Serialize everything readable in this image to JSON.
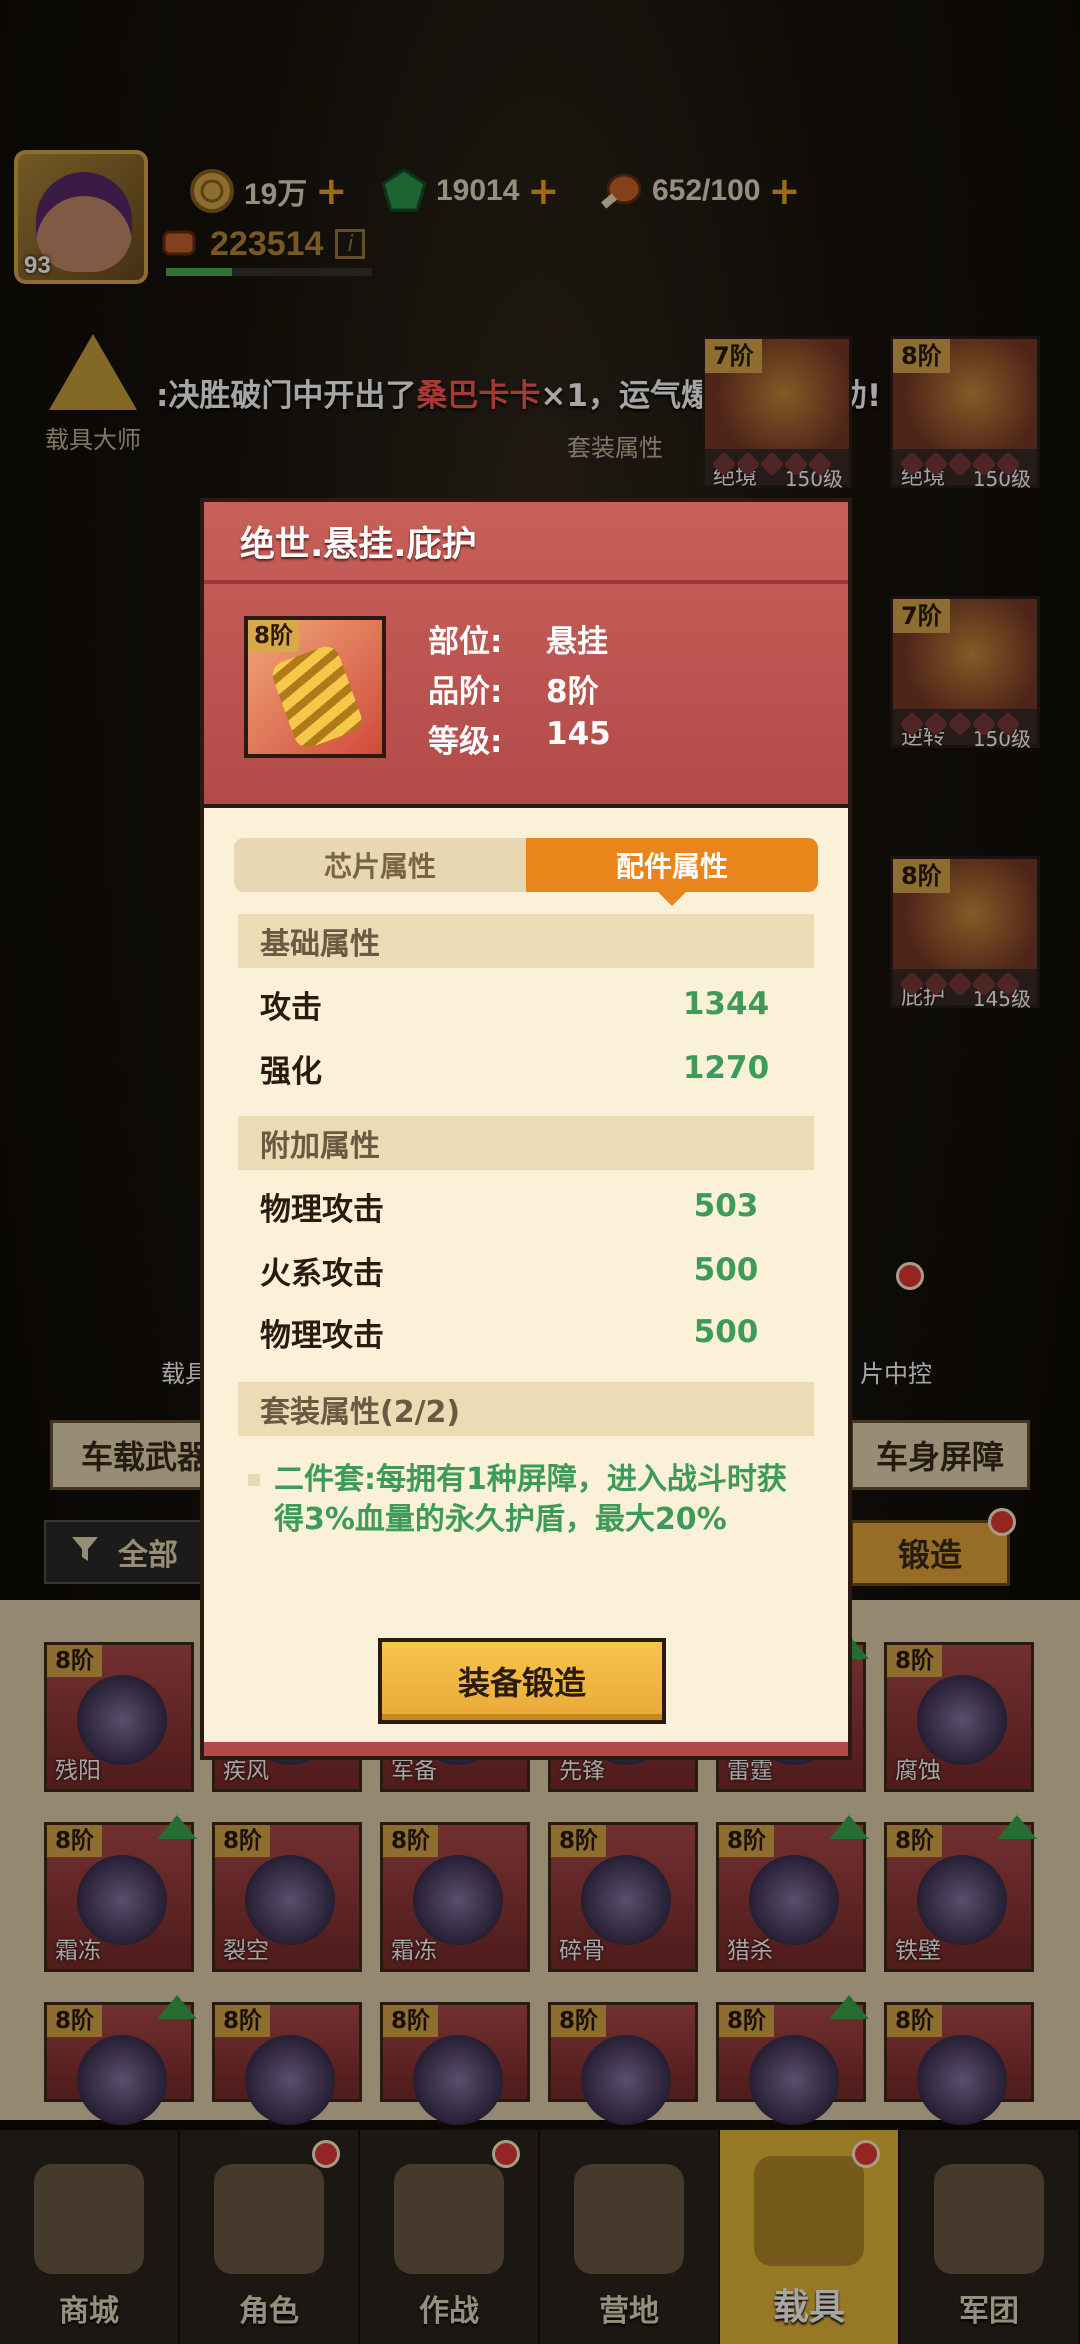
{
  "hud": {
    "player_level": "93",
    "gold": "19万",
    "gems": "19014",
    "stamina": "652/100",
    "power": "223514",
    "power_info": "i",
    "exp_progress": 0.32
  },
  "broadcast": {
    "prefix": ":决胜破门中开出了",
    "highlight": "桑巴卡卡",
    "suffix": "×1，运气爆表有如天助!"
  },
  "side_buttons": {
    "vehicle_master": "载具大师",
    "set_attributes": "套装属性",
    "vehicle_left": "载具",
    "chip_control": "片中控"
  },
  "right_gear": [
    {
      "tier": "7阶",
      "name": "绝境",
      "level": "150级"
    },
    {
      "tier": "8阶",
      "name": "绝境",
      "level": "150级"
    },
    {
      "tier": "7阶",
      "name": "逆转",
      "level": "150级"
    },
    {
      "tier": "8阶",
      "name": "庇护",
      "level": "145级"
    }
  ],
  "bg_tabs": {
    "left": "车载武器",
    "right": "车身屏障",
    "filter": "全部",
    "forge": "锻造"
  },
  "inventory": [
    {
      "tier": "8阶",
      "name": "残阳"
    },
    {
      "tier": "",
      "name": "疾风"
    },
    {
      "tier": "",
      "name": "军备"
    },
    {
      "tier": "",
      "name": "先锋"
    },
    {
      "tier": "",
      "name": "雷霆"
    },
    {
      "tier": "8阶",
      "name": "腐蚀"
    },
    {
      "tier": "8阶",
      "name": "霜冻"
    },
    {
      "tier": "8阶",
      "name": "裂空"
    },
    {
      "tier": "8阶",
      "name": "霜冻"
    },
    {
      "tier": "8阶",
      "name": "碎骨"
    },
    {
      "tier": "8阶",
      "name": "猎杀"
    },
    {
      "tier": "8阶",
      "name": "铁壁"
    },
    {
      "tier": "8阶",
      "name": ""
    },
    {
      "tier": "8阶",
      "name": ""
    },
    {
      "tier": "8阶",
      "name": ""
    },
    {
      "tier": "8阶",
      "name": ""
    },
    {
      "tier": "8阶",
      "name": ""
    },
    {
      "tier": "8阶",
      "name": ""
    }
  ],
  "nav": [
    {
      "label": "商城",
      "icon": "cart-icon"
    },
    {
      "label": "角色",
      "icon": "character-icon"
    },
    {
      "label": "作战",
      "icon": "battle-icon"
    },
    {
      "label": "营地",
      "icon": "camp-icon"
    },
    {
      "label": "载具",
      "icon": "vehicle-icon"
    },
    {
      "label": "军团",
      "icon": "legion-icon"
    }
  ],
  "modal": {
    "title": "绝世.悬挂.庇护",
    "item_tier": "8阶",
    "info": [
      {
        "key": "部位:",
        "value": "悬挂"
      },
      {
        "key": "品阶:",
        "value": "8阶"
      },
      {
        "key": "等级:",
        "value": "145"
      }
    ],
    "tab_chip": "芯片属性",
    "tab_parts": "配件属性",
    "base_header": "基础属性",
    "base_attrs": [
      {
        "key": "攻击",
        "value": "1344"
      },
      {
        "key": "强化",
        "value": "1270"
      }
    ],
    "extra_header": "附加属性",
    "extra_attrs": [
      {
        "key": "物理攻击",
        "value": "503"
      },
      {
        "key": "火系攻击",
        "value": "500"
      },
      {
        "key": "物理攻击",
        "value": "500"
      }
    ],
    "set_header": "套装属性(2/2)",
    "set_desc": "二件套:每拥有1种屏障，进入战斗时获得3%血量的永久护盾，最大20%",
    "forge_button": "装备锻造"
  },
  "colors": {
    "accent_orange": "#e8861c",
    "attr_green": "#3e9a5a",
    "header_red": "#b24a48",
    "highlight_red": "#ff5a4e"
  }
}
